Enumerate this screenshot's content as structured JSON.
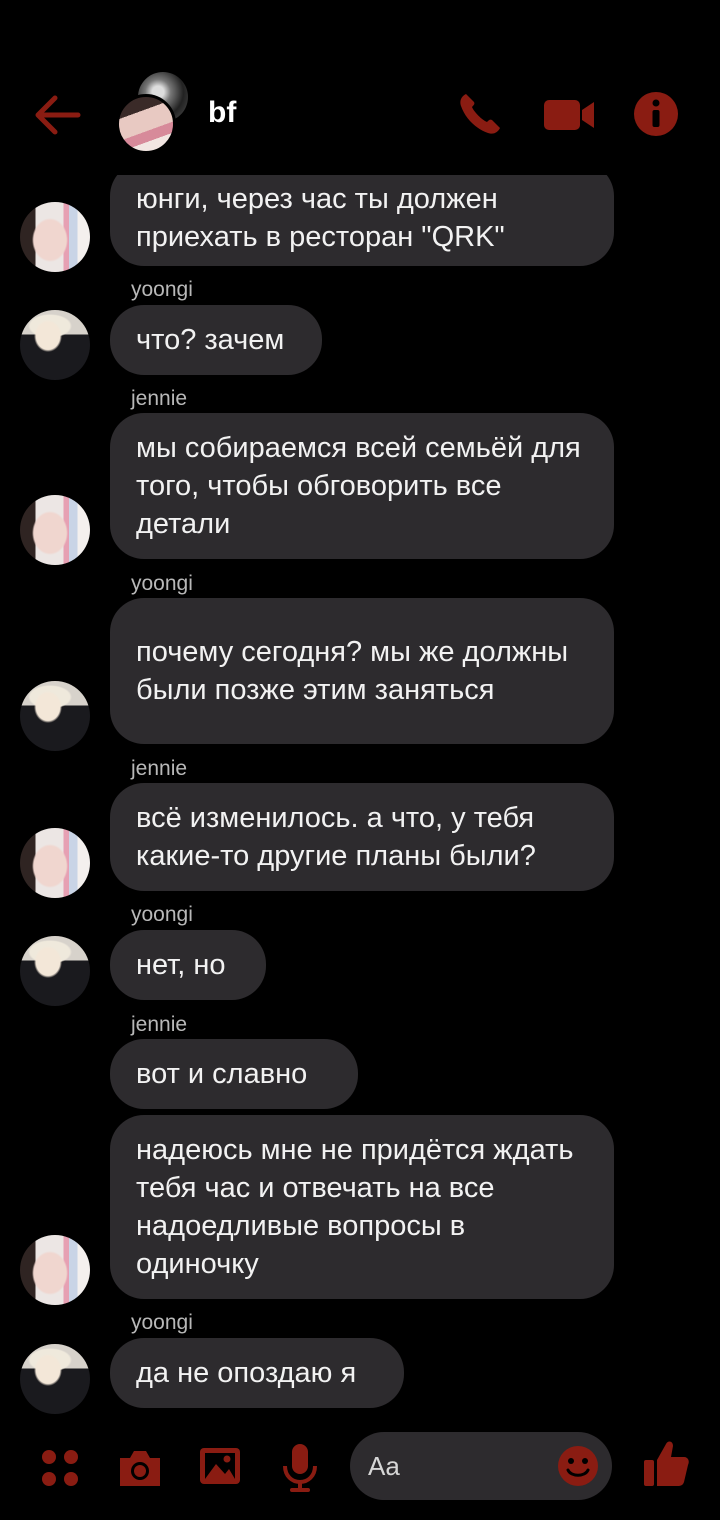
{
  "colors": {
    "accent": "#8a1c12",
    "bubble": "#2d2b2e",
    "background": "#000000"
  },
  "header": {
    "back_icon": "arrow-left-icon",
    "title": "bf",
    "call_icon": "phone-icon",
    "video_icon": "video-camera-icon",
    "info_icon": "info-icon"
  },
  "messages": [
    {
      "sender": "",
      "avatar": "jennie",
      "text": "юнги, через час ты должен приехать в ресторан \"QRK\""
    },
    {
      "sender": "yoongi",
      "avatar": "yoongi",
      "text": "что? зачем"
    },
    {
      "sender": "jennie",
      "avatar": "jennie",
      "text": "мы собираемся всей семьёй для того, чтобы обговорить все детали"
    },
    {
      "sender": "yoongi",
      "avatar": "yoongi",
      "text": "почему сегодня? мы же должны были позже этим заняться"
    },
    {
      "sender": "jennie",
      "avatar": "jennie",
      "text": "всё изменилось. а что, у тебя какие-то другие планы были?"
    },
    {
      "sender": "yoongi",
      "avatar": "yoongi",
      "text": "нет, но"
    },
    {
      "sender": "jennie",
      "avatar": "",
      "text": "вот и славно"
    },
    {
      "sender": "",
      "avatar": "jennie",
      "text": "надеюсь мне не придётся ждать тебя час и отвечать на все надоедливые вопросы в одиночку"
    },
    {
      "sender": "yoongi",
      "avatar": "yoongi",
      "text": "да не опоздаю я"
    }
  ],
  "composer": {
    "apps_icon": "four-dots-icon",
    "camera_icon": "camera-icon",
    "gallery_icon": "image-icon",
    "mic_icon": "microphone-icon",
    "placeholder": "Aa",
    "emoji_icon": "smiley-icon",
    "like_icon": "thumbs-up-icon"
  }
}
